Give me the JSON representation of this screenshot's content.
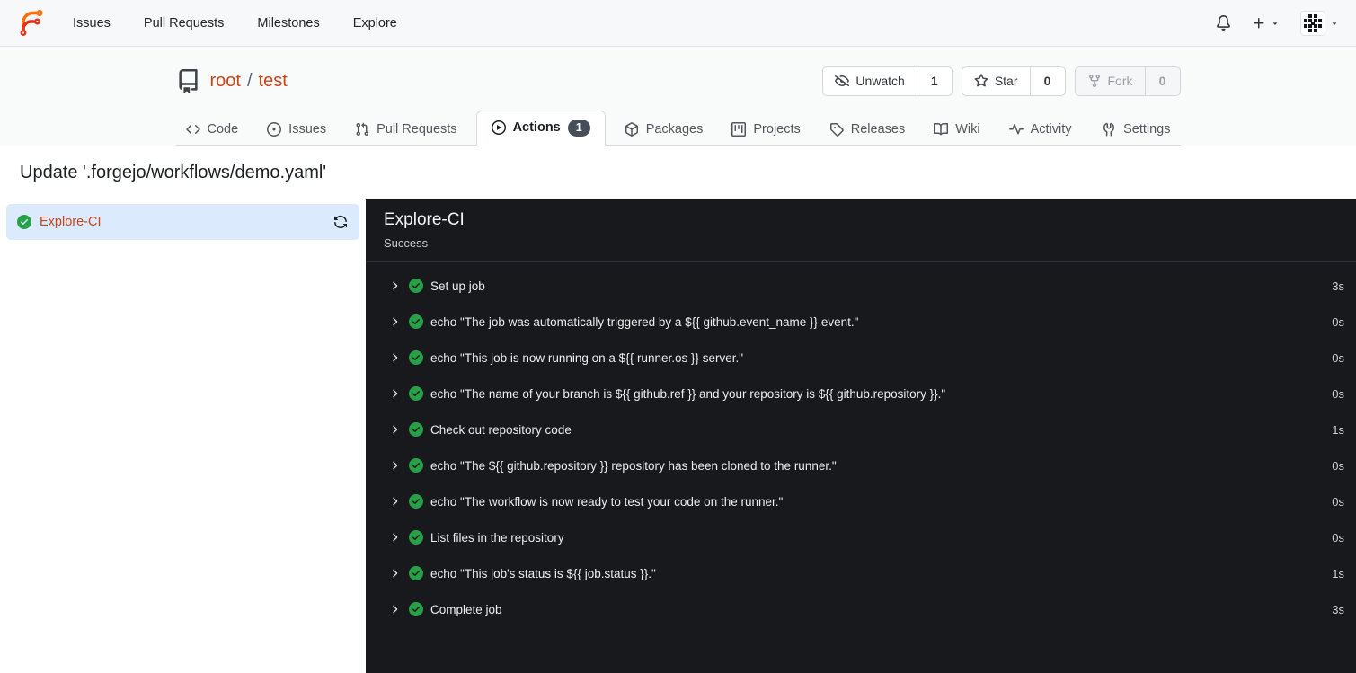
{
  "navbar": {
    "items": [
      {
        "label": "Issues"
      },
      {
        "label": "Pull Requests"
      },
      {
        "label": "Milestones"
      },
      {
        "label": "Explore"
      }
    ],
    "right_icons": [
      "bell-icon",
      "plus-icon",
      "avatar-identicon"
    ]
  },
  "repo": {
    "icon": "repo-icon",
    "owner": "root",
    "separator": "/",
    "name": "test"
  },
  "repo_actions": {
    "unwatch": {
      "icon": "eye-closed-icon",
      "label": "Unwatch",
      "count": "1"
    },
    "star": {
      "icon": "star-icon",
      "label": "Star",
      "count": "0"
    },
    "fork": {
      "icon": "fork-icon",
      "label": "Fork",
      "count": "0",
      "disabled": true
    }
  },
  "tabs": [
    {
      "label": "Code",
      "icon": "code-icon"
    },
    {
      "label": "Issues",
      "icon": "issue-opened-icon"
    },
    {
      "label": "Pull Requests",
      "icon": "pull-request-icon"
    },
    {
      "label": "Actions",
      "icon": "play-circle-icon",
      "badge": "1",
      "active": true
    },
    {
      "label": "Packages",
      "icon": "package-icon"
    },
    {
      "label": "Projects",
      "icon": "project-icon"
    },
    {
      "label": "Releases",
      "icon": "tag-icon"
    },
    {
      "label": "Wiki",
      "icon": "book-icon"
    },
    {
      "label": "Activity",
      "icon": "pulse-icon"
    },
    {
      "label": "Settings",
      "icon": "tools-icon"
    }
  ],
  "page": {
    "title": "Update '.forgejo/workflows/demo.yaml'"
  },
  "jobs_sidebar": {
    "job": {
      "label": "Explore-CI",
      "status_icon": "check-circle-icon",
      "rerun_icon": "sync-icon",
      "selected": true
    }
  },
  "run_panel": {
    "title": "Explore-CI",
    "status": "Success",
    "steps": [
      {
        "name": "Set up job",
        "duration": "3s"
      },
      {
        "name": "echo \"The job was automatically triggered by a ${{ github.event_name }} event.\"",
        "duration": "0s"
      },
      {
        "name": "echo \"This job is now running on a ${{ runner.os }} server.\"",
        "duration": "0s"
      },
      {
        "name": "echo \"The name of your branch is ${{ github.ref }} and your repository is ${{ github.repository }}.\"",
        "duration": "0s"
      },
      {
        "name": "Check out repository code",
        "duration": "1s"
      },
      {
        "name": "echo \"The ${{ github.repository }} repository has been cloned to the runner.\"",
        "duration": "0s"
      },
      {
        "name": "echo \"The workflow is now ready to test your code on the runner.\"",
        "duration": "0s"
      },
      {
        "name": "List files in the repository",
        "duration": "0s"
      },
      {
        "name": "echo \"This job's status is ${{ job.status }}.\"",
        "duration": "1s"
      },
      {
        "name": "Complete job",
        "duration": "3s"
      }
    ]
  },
  "colors": {
    "accent_link": "#c9461a",
    "success_green": "#26a148",
    "panel_bg": "#17191d",
    "sidebar_selected_bg": "#dbeafc",
    "badge_bg": "#454e59",
    "navbar_bg": "#f7f8f9"
  }
}
